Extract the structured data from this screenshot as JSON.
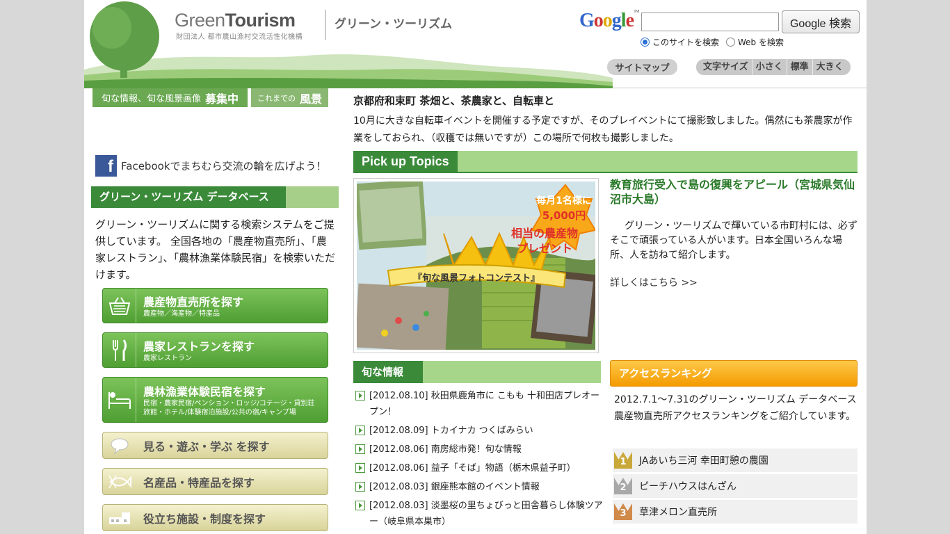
{
  "header": {
    "logo_en_light": "Green",
    "logo_en_bold": "Tourism",
    "logo_sub": "財団法人 都市農山漁村交流活性化機構",
    "logo_ja": "グリーン・ツーリズム",
    "google_logo": "Google",
    "google_tm": "TM",
    "search_button": "Google 検索",
    "search_value": "",
    "radio_site": "このサイトを検索",
    "radio_web": "Web を検索",
    "sitemap": "サイトマップ",
    "font_size_label": "文字サイズ",
    "font_small": "小さく",
    "font_standard": "標準",
    "font_large": "大きく"
  },
  "left": {
    "tag1_text": "旬な情報、旬な風景画像",
    "tag1_bold": "募集中",
    "tag2_text": "これまでの",
    "tag2_bold": "風景",
    "facebook_text": "Facebookでまちむら交流の輪を広げよう！",
    "facebook_icon": "f",
    "db_title": "グリーン・ツーリズム データベース",
    "db_text": "グリーン・ツーリズムに関する検索システムをご提供しています。 全国各地の「農産物直売所」、「農家レストラン」、「農林漁業体験民宿」を検索いただけます。",
    "buttons": [
      {
        "main": "農産物直売所を探す",
        "sub": "農産物／海産物／特産品",
        "icon": "basket-icon"
      },
      {
        "main": "農家レストランを探す",
        "sub": "農家レストラン",
        "icon": "fork-knife-icon"
      },
      {
        "main": "農林漁業体験民宿を探す",
        "sub": "民宿・農家民宿/ペンション・ロッジ/コテージ・貸別荘 旅館・ホテル/体験宿泊施設/公共の宿/キャンプ場",
        "icon": "bed-icon"
      },
      {
        "main": "見る・遊ぶ・学ぶ を探す",
        "icon": "speech-icon"
      },
      {
        "main": "名産品・特産品を探す",
        "icon": "fish-icon"
      },
      {
        "main": "役立ち施設・制度を探す",
        "icon": "building-icon"
      }
    ]
  },
  "intro": {
    "title": "京都府和束町 茶畑と、茶農家と、自転車と",
    "text": "10月に大きな自転車イベントを開催する予定ですが、そのプレイベントにて撮影致しました。偶然にも茶農家が作業をしておられ、（収穫では無いですが）この場所で何枚も撮影しました。"
  },
  "pickup": {
    "heading": "Pick up Topics",
    "banner_line1": "毎月1名様に",
    "banner_line2": "5,000円",
    "banner_line3": "相当の農産物",
    "banner_line4": "プレゼント",
    "banner_ribbon": "『旬な風景フォトコンテスト』",
    "topic_title": "教育旅行受入で島の復興をアピール（宮城県気仙沼市大島）",
    "topic_body": "グリーン・ツーリズムで輝いている市町村には、必ずそこで頑張っている人がいます。日本全国いろんな場所、人を訪ねて紹介します。",
    "more": "詳しくはこちら >>"
  },
  "news": {
    "heading": "旬な情報",
    "items": [
      "[2012.08.10] 秋田県鹿角市に こもも 十和田店プレオープン！",
      "[2012.08.09] トカイナカ つくばみらい",
      "[2012.08.06] 南房総市発！旬な情報",
      "[2012.08.06] 益子「そば」物語（栃木県益子町）",
      "[2012.08.03] 銀座熊本館のイベント情報",
      "[2012.08.03] 淡墨桜の里ちょびっと田舎暮らし体験ツアー（岐阜県本巣市）"
    ]
  },
  "ranking": {
    "heading": "アクセスランキング",
    "text": "2012.7.1～7.31のグリーン・ツーリズム データベース農産物直売所アクセスランキングをご紹介しています。",
    "items": [
      {
        "rank": "1",
        "name": "JAあいち三河 幸田町憩の農園",
        "color": "#c9a83a"
      },
      {
        "rank": "2",
        "name": "ピーチハウスはんざん",
        "color": "#a8a8a8"
      },
      {
        "rank": "3",
        "name": "草津メロン直売所",
        "color": "#d08a4a"
      }
    ]
  }
}
